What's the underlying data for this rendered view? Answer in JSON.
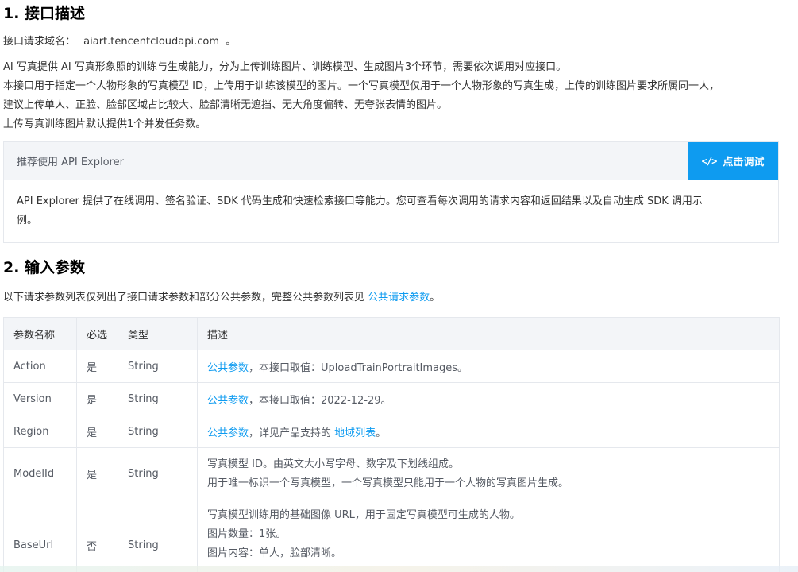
{
  "section1": {
    "title": "1. 接口描述",
    "domain_label": "接口请求域名：",
    "domain_value": "aiart.tencentcloudapi.com",
    "domain_suffix": "。",
    "desc_lines": [
      "AI 写真提供 AI 写真形象照的训练与生成能力，分为上传训练图片、训练模型、生成图片3个环节，需要依次调用对应接口。",
      "本接口用于指定一个人物形象的写真模型 ID，上传用于训练该模型的图片。一个写真模型仅用于一个人物形象的写真生成，上传的训练图片要求所属同一人，",
      "建议上传单人、正脸、脸部区域占比较大、脸部清晰无遮挡、无大角度偏转、无夸张表情的图片。",
      "上传写真训练图片默认提供1个并发任务数。"
    ]
  },
  "explorer": {
    "title": "推荐使用 API Explorer",
    "button_icon": "code-icon",
    "button_label": "点击调试",
    "body_line1": "API Explorer 提供了在线调用、签名验证、SDK 代码生成和快速检索接口等能力。您可查看每次调用的请求内容和返回结果以及自动生成 SDK 调用示",
    "body_line2": "例。"
  },
  "section2": {
    "title": "2. 输入参数",
    "intro_prefix": "以下请求参数列表仅列出了接口请求参数和部分公共参数，完整公共参数列表见 ",
    "intro_link": "公共请求参数",
    "intro_suffix": "。"
  },
  "table": {
    "headers": [
      "参数名称",
      "必选",
      "类型",
      "描述"
    ],
    "rows": [
      {
        "name": "Action",
        "required": "是",
        "type": "String",
        "link": "公共参数",
        "text": "，本接口取值：UploadTrainPortraitImages。"
      },
      {
        "name": "Version",
        "required": "是",
        "type": "String",
        "link": "公共参数",
        "text": "，本接口取值：2022-12-29。"
      },
      {
        "name": "Region",
        "required": "是",
        "type": "String",
        "link": "公共参数",
        "text": "，详见产品支持的 ",
        "link2": "地域列表",
        "text2": "。"
      },
      {
        "name": "ModelId",
        "required": "是",
        "type": "String",
        "lines": [
          "写真模型 ID。由英文大小写字母、数字及下划线组成。",
          "用于唯一标识一个写真模型，一个写真模型只能用于一个人物的写真图片生成。"
        ]
      },
      {
        "name": "BaseUrl",
        "required": "否",
        "type": "String",
        "lines": [
          "写真模型训练用的基础图像 URL，用于固定写真模型可生成的人物。",
          "图片数量：1张。",
          "图片内容：单人，脸部清晰。"
        ]
      }
    ]
  },
  "colors": {
    "link": "#0e9bf0",
    "button_bg": "#0e9bf0",
    "header_bg": "#f3f5f8",
    "border": "#e5e8ed"
  }
}
